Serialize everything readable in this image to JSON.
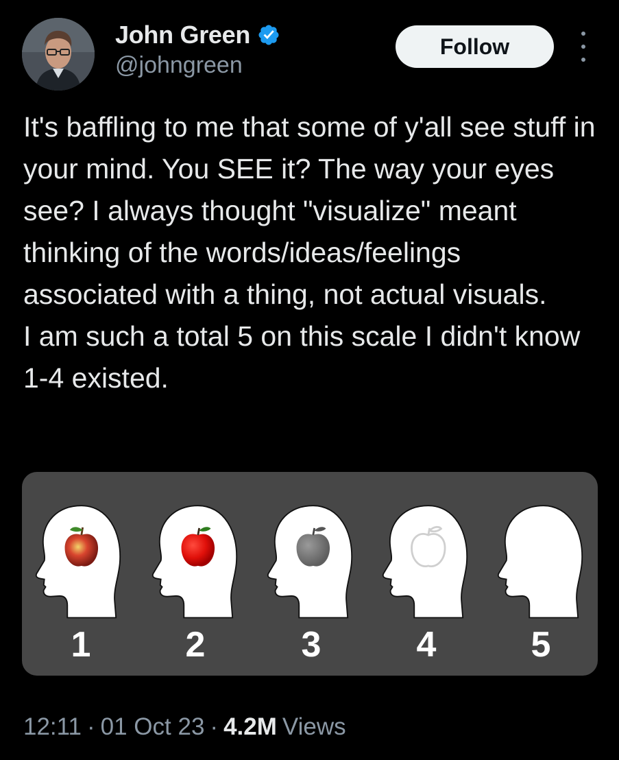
{
  "author": {
    "display_name": "John Green",
    "handle": "@johngreen",
    "verified": true,
    "verified_color": "#1d9bf0"
  },
  "actions": {
    "follow_label": "Follow",
    "more_icon": "more-vertical-icon"
  },
  "tweet": {
    "paragraphs": [
      "It's baffling to me that some of y'all see stuff in your mind. You SEE it? The way your eyes see? I always thought \"visualize\" meant thinking of the words/ideas/feelings associated with a thing, not actual visuals.",
      "I am such a total 5 on this scale I didn't know 1-4 existed."
    ]
  },
  "media": {
    "scale_labels": [
      "1",
      "2",
      "3",
      "4",
      "5"
    ],
    "apple_styles": [
      "realistic",
      "bright-red",
      "gray",
      "outline",
      "none"
    ]
  },
  "meta": {
    "time": "12:11",
    "date": "01 Oct 23",
    "separator": "·",
    "views_count": "4.2M",
    "views_label": "Views"
  }
}
